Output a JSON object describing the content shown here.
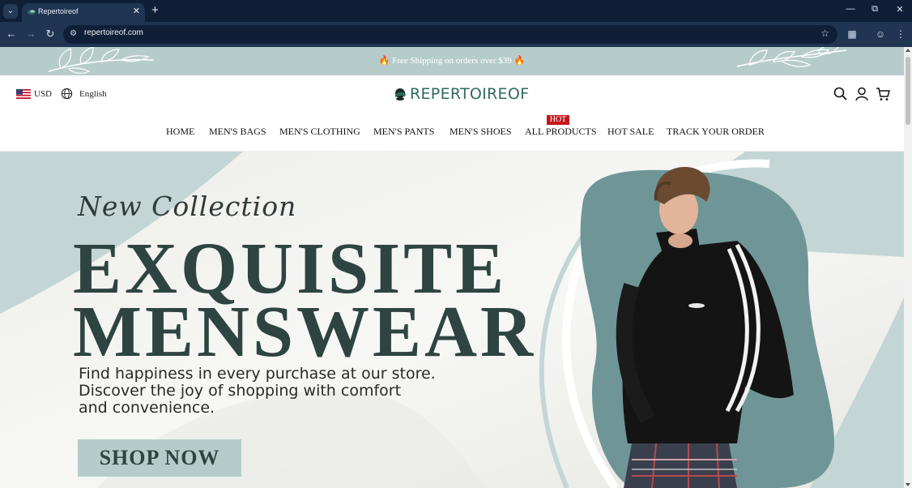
{
  "browser": {
    "tab_title": "Repertoireof",
    "url": "repertoireof.com"
  },
  "announcement": {
    "text": "🔥 Free Shipping on orders over $39 🔥"
  },
  "header": {
    "currency": "USD",
    "language": "English",
    "logo_text": "REPERTOIREOF"
  },
  "nav": {
    "items": [
      "HOME",
      "MEN'S BAGS",
      "MEN'S CLOTHING",
      "MEN'S PANTS",
      "MEN'S SHOES",
      "ALL PRODUCTS",
      "HOT SALE",
      "TRACK YOUR ORDER"
    ],
    "hot_badge": "HOT"
  },
  "hero": {
    "script_title": "New Collection",
    "headline_line1": "EXQUISITE",
    "headline_line2": "MENSWEAR",
    "tagline_line1": "Find happiness in every purchase at our store.",
    "tagline_line2": "Discover the joy of shopping with comfort",
    "tagline_line3": "and convenience.",
    "cta": "SHOP NOW"
  },
  "colors": {
    "brand_green": "#2e6a5c",
    "accent_sage": "#b6cccb",
    "headline_dark": "#2e4440",
    "hot_red": "#c4161c",
    "browser_dark": "#0f1f38"
  },
  "icons": [
    "tab-list-icon",
    "favicon-icon",
    "close-icon",
    "plus-icon",
    "minimize-icon",
    "restore-icon",
    "back-icon",
    "forward-icon",
    "reload-icon",
    "site-info-icon",
    "star-icon",
    "extensions-icon",
    "profile-icon",
    "menu-icon",
    "us-flag-icon",
    "globe-icon",
    "search-icon",
    "account-icon",
    "cart-icon"
  ]
}
